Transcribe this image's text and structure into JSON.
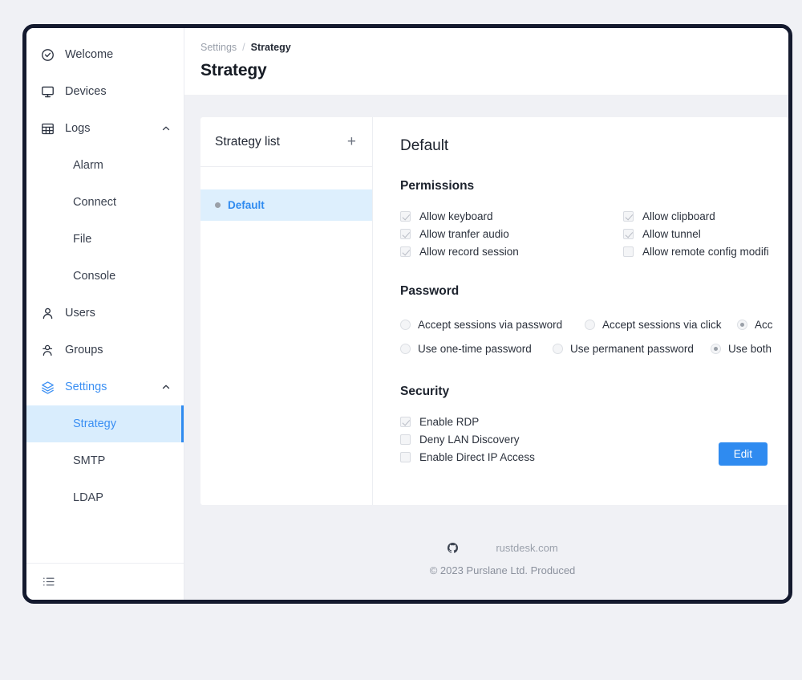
{
  "sidebar": {
    "items": [
      {
        "label": "Welcome",
        "icon": "check-circle-icon",
        "level": "top"
      },
      {
        "label": "Devices",
        "icon": "monitor-icon",
        "level": "top"
      },
      {
        "label": "Logs",
        "icon": "grid-icon",
        "level": "top",
        "caret": "chevron-up-icon"
      },
      {
        "label": "Alarm",
        "icon": "",
        "level": "sub"
      },
      {
        "label": "Connect",
        "icon": "",
        "level": "sub"
      },
      {
        "label": "File",
        "icon": "",
        "level": "sub"
      },
      {
        "label": "Console",
        "icon": "",
        "level": "sub"
      },
      {
        "label": "Users",
        "icon": "user-icon",
        "level": "top"
      },
      {
        "label": "Groups",
        "icon": "users-icon",
        "level": "top"
      },
      {
        "label": "Settings",
        "icon": "layers-icon",
        "level": "top",
        "caret": "chevron-up-icon",
        "state": "expanded"
      },
      {
        "label": "Strategy",
        "icon": "",
        "level": "sub",
        "state": "selected"
      },
      {
        "label": "SMTP",
        "icon": "",
        "level": "sub"
      },
      {
        "label": "LDAP",
        "icon": "",
        "level": "sub"
      }
    ],
    "collapse_icon": "collapse-sidebar-icon"
  },
  "header": {
    "breadcrumb_parent": "Settings",
    "breadcrumb_separator": "/",
    "breadcrumb_current": "Strategy",
    "title": "Strategy"
  },
  "strategy_list": {
    "title": "Strategy list",
    "add_label": "+",
    "rows": [
      {
        "name": "Default",
        "selected": true
      }
    ]
  },
  "detail": {
    "title": "Default",
    "permissions": {
      "section_title": "Permissions",
      "col1": [
        {
          "label": "Allow keyboard",
          "checked": true
        },
        {
          "label": "Allow tranfer audio",
          "checked": true
        },
        {
          "label": "Allow record session",
          "checked": true
        }
      ],
      "col2": [
        {
          "label": "Allow clipboard",
          "checked": true
        },
        {
          "label": "Allow tunnel",
          "checked": true
        },
        {
          "label": "Allow remote config modifi",
          "checked": false
        }
      ]
    },
    "password": {
      "section_title": "Password",
      "row1": [
        {
          "label": "Accept sessions via password",
          "selected": false
        },
        {
          "label": "Accept sessions via click",
          "selected": false
        },
        {
          "label": "Acc",
          "selected": true
        }
      ],
      "row2": [
        {
          "label": "Use one-time password",
          "selected": false
        },
        {
          "label": "Use permanent password",
          "selected": false
        },
        {
          "label": "Use both",
          "selected": true
        }
      ]
    },
    "security": {
      "section_title": "Security",
      "items": [
        {
          "label": "Enable RDP",
          "checked": true
        },
        {
          "label": "Deny LAN Discovery",
          "checked": false
        },
        {
          "label": "Enable Direct IP Access",
          "checked": false
        }
      ]
    },
    "edit_label": "Edit"
  },
  "footer": {
    "github_icon": "github-icon",
    "site_label": "rustdesk.com",
    "copyright": "© 2023 Purslane Ltd. Produced"
  },
  "colors": {
    "accent": "#2f8bf0",
    "selected_row_bg": "#ddeffd",
    "page_bg": "#f0f1f5",
    "frame": "#141a2e"
  }
}
